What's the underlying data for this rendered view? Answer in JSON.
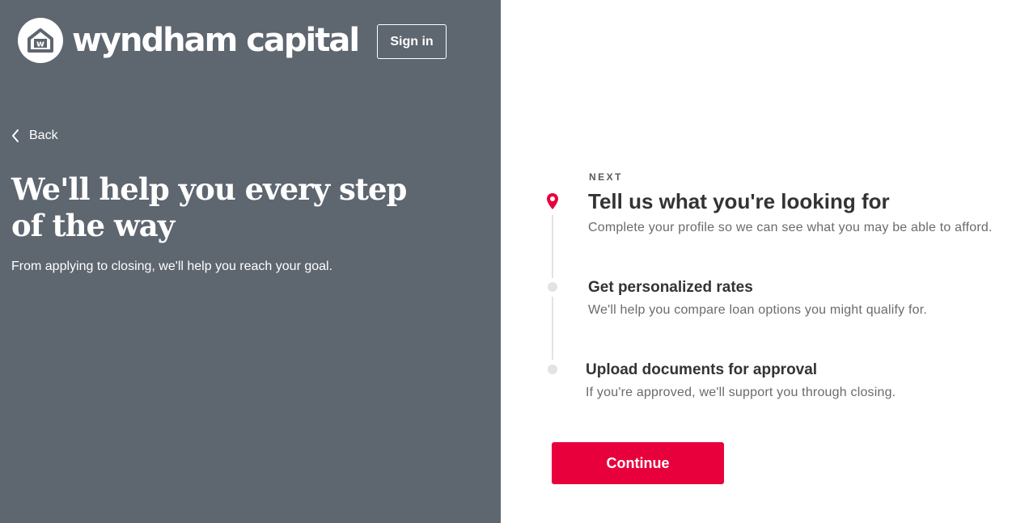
{
  "brand": {
    "name": "wyndham capital",
    "badge_letter": "w"
  },
  "header": {
    "signin_label": "Sign in"
  },
  "nav": {
    "back_label": "Back"
  },
  "hero": {
    "headline": "We'll help you every step of the way",
    "subhead": "From applying to closing, we'll help you reach your goal."
  },
  "steps": {
    "next_label": "NEXT",
    "items": [
      {
        "title": "Tell us what you're looking for",
        "description": "Complete your profile so we can see what you may be able to afford.",
        "state": "current",
        "icon": "location-pin-icon"
      },
      {
        "title": "Get personalized rates",
        "description": "We'll help you compare loan options you might qualify for.",
        "state": "upcoming"
      },
      {
        "title": "Upload documents for approval",
        "description": "If you're approved, we'll support you through closing.",
        "state": "upcoming"
      }
    ]
  },
  "actions": {
    "continue_label": "Continue"
  },
  "colors": {
    "panel": "#5e6670",
    "accent": "#e8003c",
    "step_line": "#e3e3e3",
    "title_text": "#333333",
    "body_text": "#6b6b6b"
  }
}
